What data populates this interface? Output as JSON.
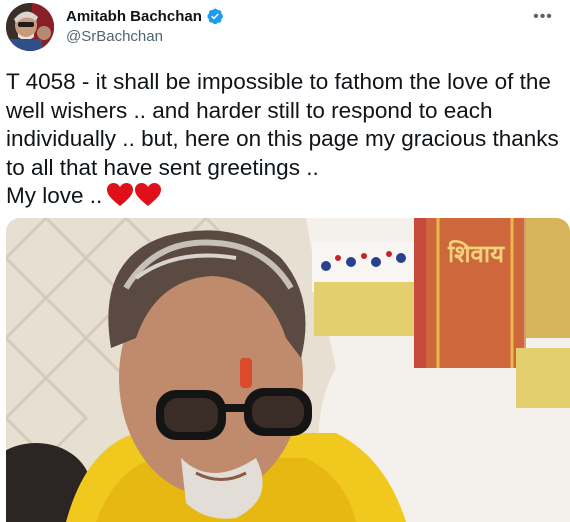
{
  "author": {
    "display_name": "Amitabh Bachchan",
    "handle": "@SrBachchan",
    "verified": true,
    "avatar_icon": "profile-photo"
  },
  "menu": {
    "more_icon": "more-horizontal-icon",
    "glyph": "•••"
  },
  "tweet": {
    "text": "T 4058 - it shall be impossible to fathom the love of the well wishers .. and harder still to respond to each individually .. but, here on this page my gracious thanks to all that have sent greetings ..\nMy love ..",
    "emoji": [
      "red-heart",
      "red-heart"
    ]
  },
  "media": {
    "type": "photo",
    "overlay_text": "शिवाय"
  },
  "colors": {
    "text_primary": "#0f1419",
    "text_secondary": "#536471",
    "verified_blue": "#1d9bf0",
    "heart_red": "#e0101a"
  }
}
